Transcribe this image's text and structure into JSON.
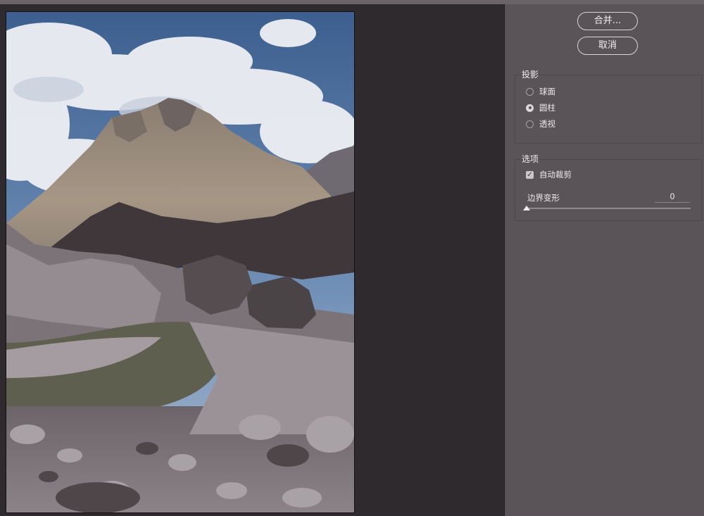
{
  "buttons": {
    "merge_label": "合并...",
    "cancel_label": "取消"
  },
  "projection": {
    "title": "投影",
    "options": [
      {
        "label": "球面",
        "selected": false
      },
      {
        "label": "圆柱",
        "selected": true
      },
      {
        "label": "透视",
        "selected": false
      }
    ]
  },
  "options": {
    "title": "选项",
    "auto_crop": {
      "label": "自动裁剪",
      "checked": true
    },
    "boundary_warp": {
      "label": "边界变形",
      "value": "0"
    }
  },
  "preview": {
    "description_icon": "mountain-photo"
  },
  "colors": {
    "panel_bg": "#5a5458",
    "preview_bg": "#2e2a2e",
    "button_border": "#d8d4d8"
  }
}
